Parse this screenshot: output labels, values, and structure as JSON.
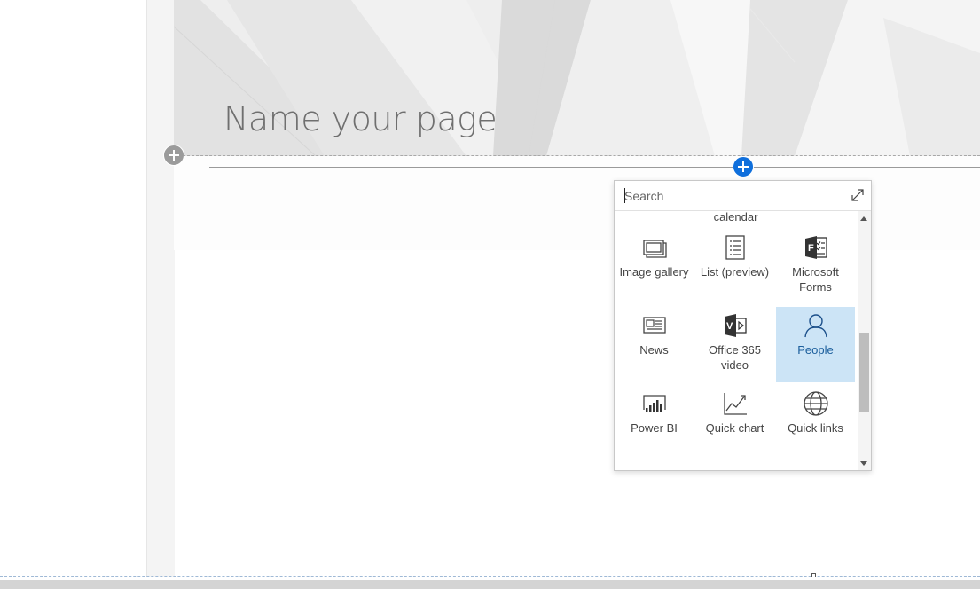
{
  "page": {
    "title_placeholder": "Name your page"
  },
  "toolbox": {
    "search_placeholder": "Search",
    "partial_top_label": "calendar",
    "tiles": [
      {
        "label": "Image gallery",
        "icon": "image-gallery-icon",
        "selected": false
      },
      {
        "label": "List (preview)",
        "icon": "list-icon",
        "selected": false
      },
      {
        "label": "Microsoft Forms",
        "icon": "microsoft-forms-icon",
        "selected": false
      },
      {
        "label": "News",
        "icon": "news-icon",
        "selected": false
      },
      {
        "label": "Office 365 video",
        "icon": "office-365-video-icon",
        "selected": false
      },
      {
        "label": "People",
        "icon": "people-icon",
        "selected": true
      },
      {
        "label": "Power BI",
        "icon": "power-bi-icon",
        "selected": false
      },
      {
        "label": "Quick chart",
        "icon": "quick-chart-icon",
        "selected": false
      },
      {
        "label": "Quick links",
        "icon": "quick-links-icon",
        "selected": false
      }
    ]
  },
  "colors": {
    "accent": "#0f6fdc",
    "selected_tile": "#cce4f6"
  }
}
